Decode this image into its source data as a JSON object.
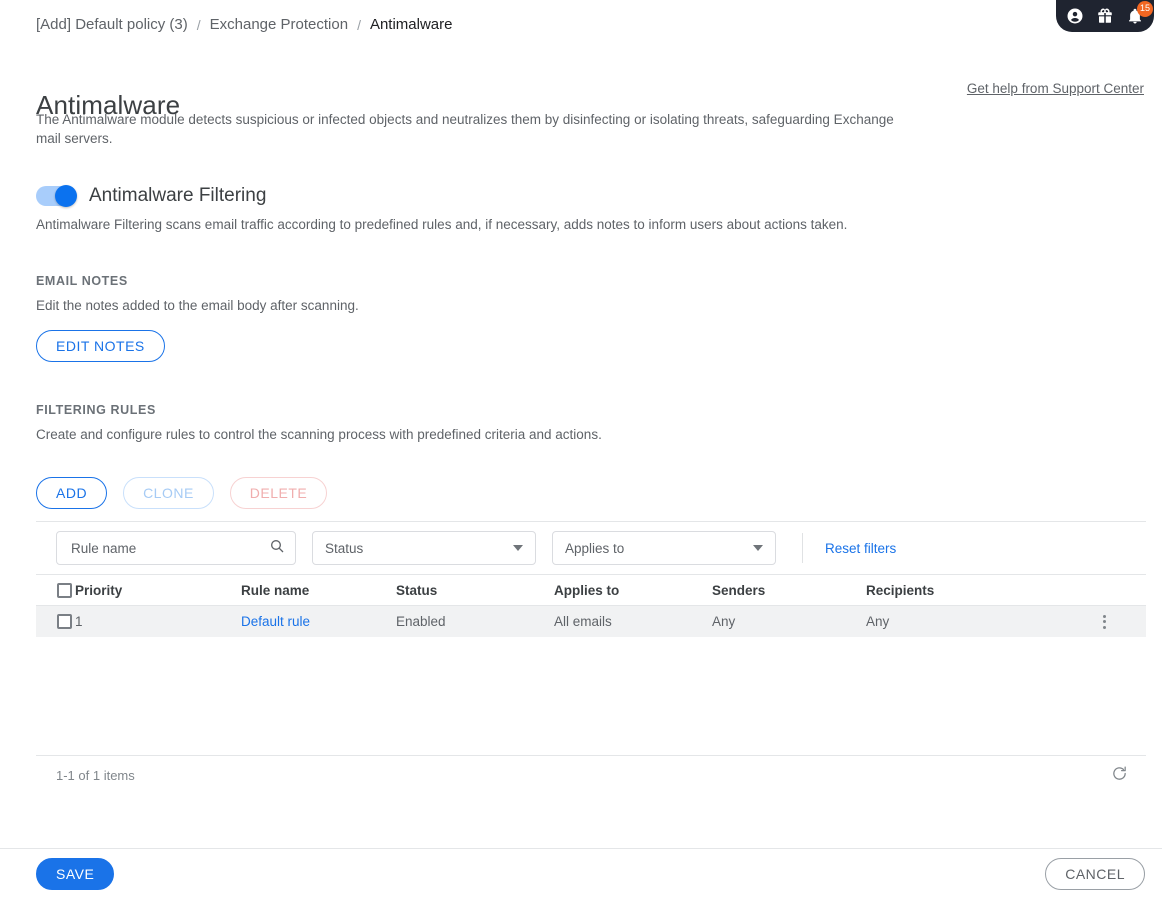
{
  "topbar": {
    "account_icon": "account-circle-icon",
    "gift_icon": "gift-icon",
    "bell_icon": "notification-bell-icon",
    "notification_count": "15"
  },
  "breadcrumb": {
    "items": [
      {
        "label": "[Add] Default policy (3)",
        "current": false
      },
      {
        "label": "Exchange Protection",
        "current": false
      },
      {
        "label": "Antimalware",
        "current": true
      }
    ],
    "separator": "/"
  },
  "header": {
    "title": "Antimalware",
    "support_link": "Get help from Support Center",
    "description": "The Antimalware module detects suspicious or infected objects and neutralizes them by disinfecting or isolating threats, safeguarding Exchange mail servers."
  },
  "filtering_toggle": {
    "label": "Antimalware Filtering",
    "state": "on",
    "description": "Antimalware Filtering scans email traffic according to predefined rules and, if necessary, adds notes to inform users about actions taken."
  },
  "email_notes": {
    "section_title": "EMAIL NOTES",
    "description": "Edit the notes added to the email body after scanning.",
    "edit_button": "EDIT NOTES"
  },
  "filtering_rules": {
    "section_title": "FILTERING RULES",
    "description": "Create and configure rules to control the scanning process with predefined criteria and actions.",
    "buttons": {
      "add": "ADD",
      "clone": "CLONE",
      "delete": "DELETE"
    },
    "filters": {
      "search_placeholder": "Rule name",
      "search_value": "",
      "search_icon": "search-icon",
      "status_select": "Status",
      "applies_to_select": "Applies to",
      "reset_link": "Reset filters"
    },
    "table": {
      "columns": [
        "Priority",
        "Rule name",
        "Status",
        "Applies to",
        "Senders",
        "Recipients"
      ],
      "rows": [
        {
          "priority": "1",
          "rule_name": "Default rule",
          "status": "Enabled",
          "applies_to": "All emails",
          "senders": "Any",
          "recipients": "Any",
          "selected": false
        }
      ],
      "footer_count": "1-1 of 1 items",
      "refresh_icon": "refresh-icon"
    }
  },
  "footer": {
    "save": "SAVE",
    "cancel": "CANCEL"
  },
  "colors": {
    "accent_blue": "#1a73e8",
    "toggle_on": "#0b72ef",
    "badge_orange": "#f26722",
    "topbar_dark": "#1f2430",
    "row_highlight": "#f1f2f3"
  }
}
